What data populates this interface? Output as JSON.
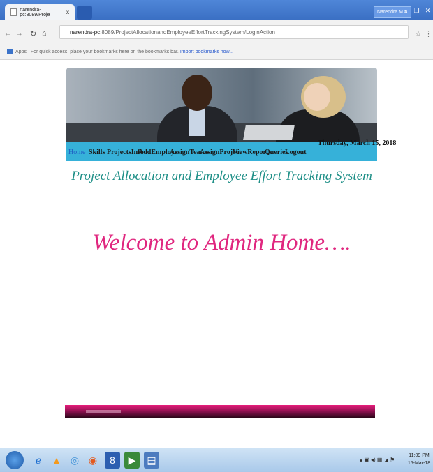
{
  "browser": {
    "tab_title": "narendra-pc:8089/Proje",
    "tab_close": "x",
    "user_label": "Narendra M.A",
    "url_host": "narendra-pc",
    "url_rest": ":8089/ProjectAllocationandEmployeeEffortTrackingSystem/LoginAction",
    "bookmarks_apps": "Apps",
    "bookmarks_text": "For quick access, place your bookmarks here on the bookmarks bar.",
    "bookmarks_link": "Import bookmarks now..."
  },
  "page": {
    "date": "Thursday, March 15, 2018",
    "nav": [
      {
        "label": "Home"
      },
      {
        "label": "Skills"
      },
      {
        "label": "ProjectsInfo"
      },
      {
        "label": "AddEmployes"
      },
      {
        "label": "AssignTeams"
      },
      {
        "label": "AssignProject"
      },
      {
        "label": "ViewReports"
      },
      {
        "label": "Queries"
      },
      {
        "label": "Logout"
      }
    ],
    "system_title": "Project Allocation and Employee Effort Tracking System",
    "welcome": "Welcome to Admin Home…."
  },
  "taskbar": {
    "time": "11:09 PM",
    "date": "15-Mar-18"
  },
  "colors": {
    "nav_bar": "#36b1d9",
    "title": "#1e8f87",
    "welcome": "#e0277f"
  }
}
